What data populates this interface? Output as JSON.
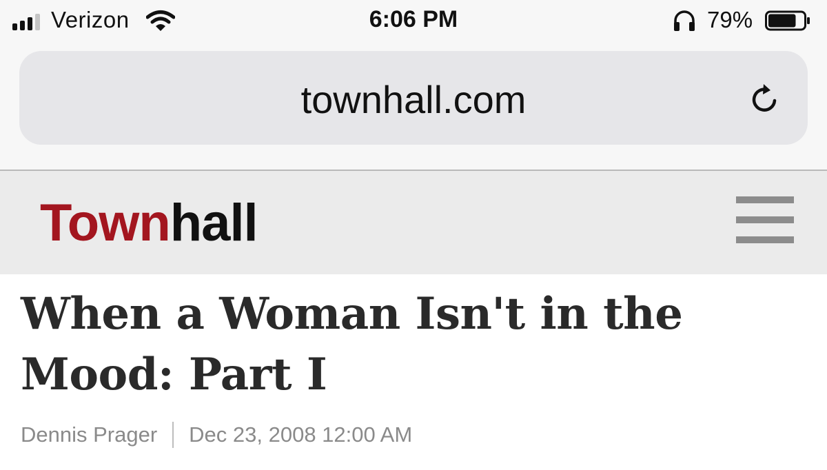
{
  "status_bar": {
    "carrier": "Verizon",
    "time": "6:06 PM",
    "battery_percent": "79%",
    "battery_level": 0.79,
    "icons": [
      "signal-icon",
      "wifi-icon",
      "headphones-icon",
      "battery-icon"
    ]
  },
  "browser": {
    "url": "townhall.com",
    "reload_icon": "reload-icon"
  },
  "site_header": {
    "logo_part1": "Town",
    "logo_part2": "hall",
    "logo_colors": {
      "town": "#a3161f",
      "hall": "#111111"
    },
    "menu_icon": "hamburger-menu-icon"
  },
  "article": {
    "headline": "When a Woman Isn't in the Mood: Part I",
    "author": "Dennis Prager",
    "date": "Dec 23, 2008 12:00 AM"
  }
}
